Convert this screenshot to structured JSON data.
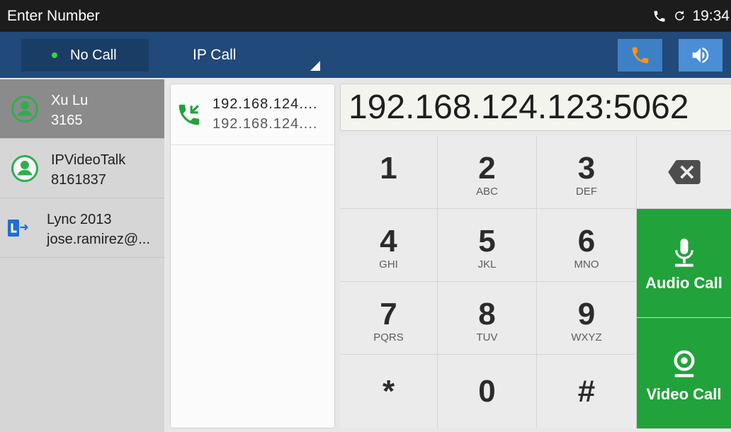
{
  "status_bar": {
    "title": "Enter Number",
    "time": "19:34",
    "icons": [
      "phone-icon",
      "sync-icon"
    ]
  },
  "toolbar": {
    "call_status": "No Call",
    "call_status_indicator": "green-dot",
    "account": "IP Call",
    "buttons": [
      {
        "icon": "handset-icon",
        "color": "#f7941d"
      },
      {
        "icon": "speaker-icon",
        "color": "#ffffff"
      }
    ]
  },
  "contacts": [
    {
      "name": "Xu Lu",
      "number": "3165",
      "icon": "contact-icon",
      "selected": true
    },
    {
      "name": "IPVideoTalk",
      "number": "8161837",
      "icon": "contact-icon",
      "selected": false
    },
    {
      "name": "Lync 2013",
      "number": "jose.ramirez@...",
      "icon": "lync-icon",
      "selected": false
    }
  ],
  "call_history": [
    {
      "primary": "192.168.124....",
      "secondary": "192.168.124....",
      "icon": "call-history-icon"
    }
  ],
  "dial_input": {
    "value": "192.168.124.123:5062"
  },
  "keypad": {
    "keys": [
      {
        "digit": "1"
      },
      {
        "digit": "2",
        "letters": "ABC"
      },
      {
        "digit": "3",
        "letters": "DEF"
      },
      {
        "digit": "4",
        "letters": "GHI"
      },
      {
        "digit": "5",
        "letters": "JKL"
      },
      {
        "digit": "6",
        "letters": "MNO"
      },
      {
        "digit": "7",
        "letters": "PQRS"
      },
      {
        "digit": "8",
        "letters": "TUV"
      },
      {
        "digit": "9",
        "letters": "WXYZ"
      },
      {
        "digit": "*"
      },
      {
        "digit": "0"
      },
      {
        "digit": "#"
      }
    ],
    "backspace_icon": "backspace-icon"
  },
  "actions": {
    "audio_call": {
      "label": "Audio Call",
      "icon": "microphone-icon"
    },
    "video_call": {
      "label": "Video Call",
      "icon": "camera-icon"
    }
  },
  "colors": {
    "status_bar_bg": "#1c1c1c",
    "toolbar_bg": "#21497a",
    "call_status_bg": "#1a3d66",
    "status_dot": "#3ad14a",
    "call_button_green": "#22a23b",
    "selected_contact_bg": "#8b8b8b",
    "handset_orange": "#f7941d",
    "contact_icon_green": "#2fae4e"
  }
}
